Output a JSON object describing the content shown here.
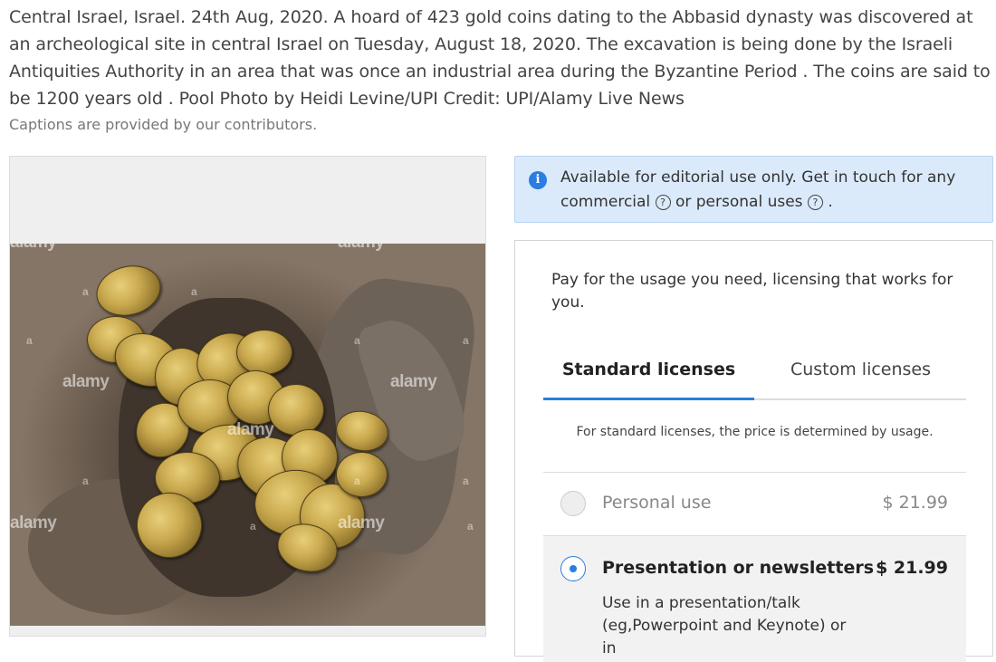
{
  "caption": "Central Israel, Israel. 24th Aug, 2020. A hoard of 423 gold coins dating to the Abbasid dynasty was discovered at an archeological site in central Israel on Tuesday, August 18, 2020. The excavation is being done by the Israeli Antiquities Authority in an area that was once an industrial area during the Byzantine Period . The coins are said to be 1200 years old . Pool Photo by Heidi Levine/UPI Credit: UPI/Alamy Live News",
  "subcaption": "Captions are provided by our contributors.",
  "image": {
    "watermark": "alamy",
    "watermark_small": "a"
  },
  "notice": {
    "icon": "info-icon",
    "text_before": "Available for editorial use only. Get in touch for any",
    "commercial": "commercial",
    "or_personal": "or personal uses",
    "end": ".",
    "help_glyph": "?"
  },
  "license": {
    "intro": "Pay for the usage you need, licensing that works for you.",
    "tabs": [
      {
        "label": "Standard licenses",
        "active": true
      },
      {
        "label": "Custom licenses",
        "active": false
      }
    ],
    "standard_note": "For standard licenses, the price is determined by usage.",
    "options": [
      {
        "label": "Personal use",
        "price": "$ 21.99",
        "selected": false,
        "description": ""
      },
      {
        "label": "Presentation or newsletters",
        "price": "$ 21.99",
        "selected": true,
        "description": "Use in a presentation/talk (eg,Powerpoint and Keynote) or in"
      }
    ]
  },
  "colors": {
    "accent": "#2a7de1",
    "notice_bg": "#dbeafb"
  }
}
